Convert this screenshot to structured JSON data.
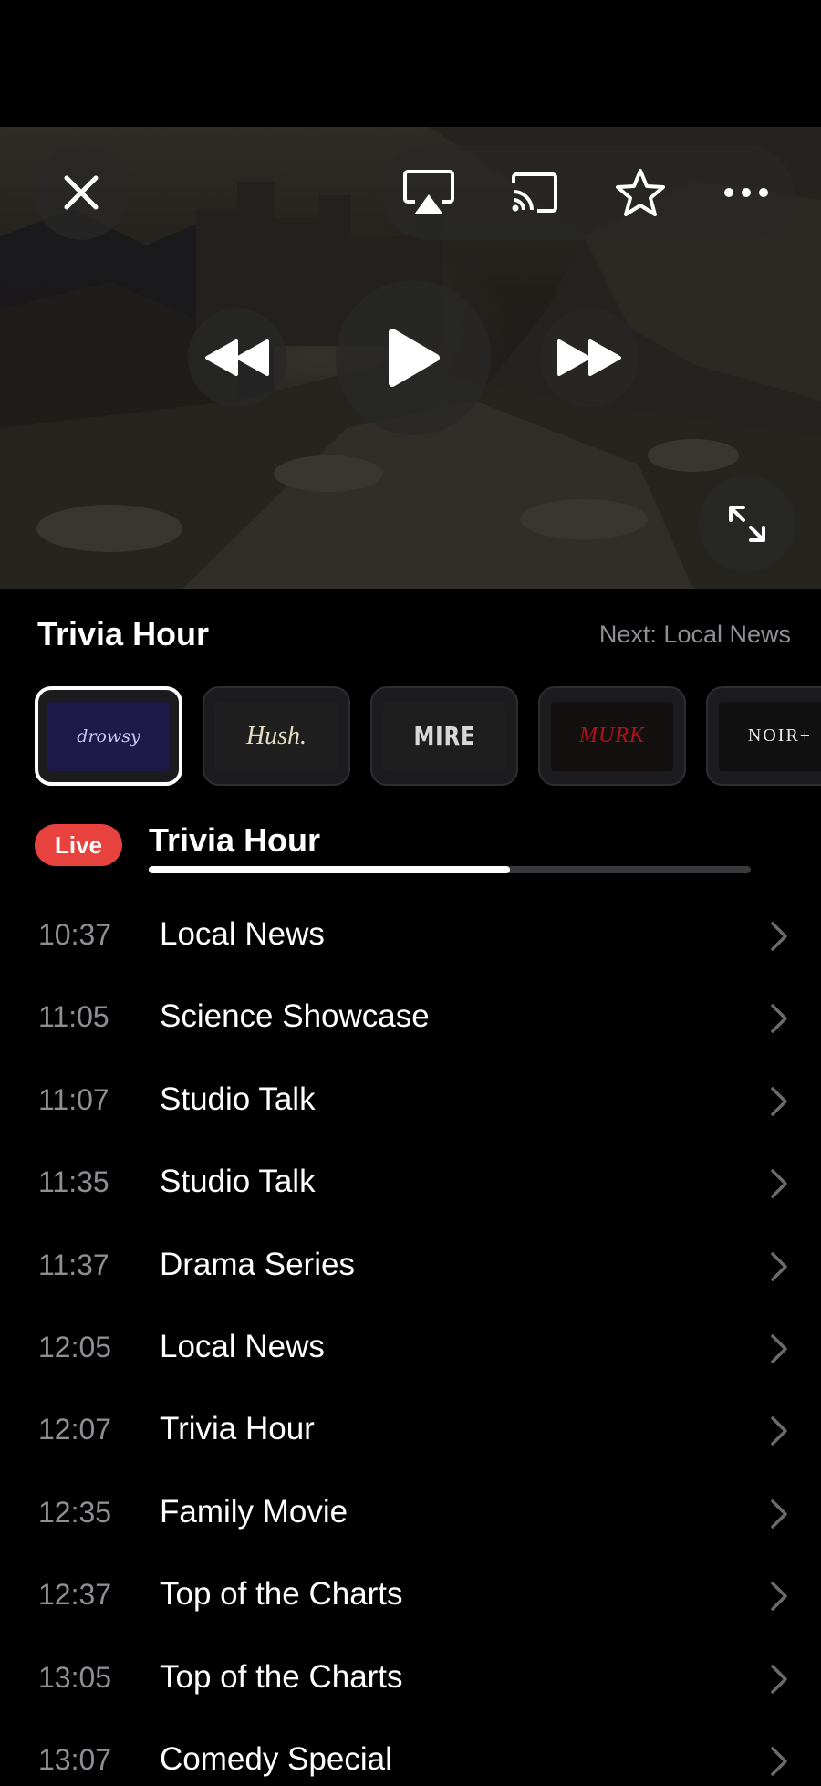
{
  "player": {
    "close_icon": "close-icon",
    "airplay_icon": "airplay-icon",
    "cast_icon": "cast-icon",
    "favorite_icon": "star-icon",
    "more_icon": "more-icon",
    "rewind_icon": "rewind-icon",
    "play_icon": "play-icon",
    "forward_icon": "fast-forward-icon",
    "fullscreen_icon": "expand-icon"
  },
  "now_playing": {
    "title": "Trivia Hour",
    "next_label": "Next: Local News"
  },
  "channels": [
    {
      "name": "drowsy",
      "logo_text": "drowsy",
      "selected": true,
      "bg": "#1d1a4a",
      "fg": "#c9c6f0"
    },
    {
      "name": "Hush.",
      "logo_text": "Hush.",
      "selected": false,
      "bg": "#1f1f1f",
      "fg": "#e6dcc4"
    },
    {
      "name": "MIRE",
      "logo_text": "MIRE",
      "selected": false,
      "bg": "#1e1e1f",
      "fg": "#d8d8d8"
    },
    {
      "name": "MURK",
      "logo_text": "MURK",
      "selected": false,
      "bg": "#141010",
      "fg": "#b0121a"
    },
    {
      "name": "NOIR+",
      "logo_text": "NOIR+",
      "selected": false,
      "bg": "#111111",
      "fg": "#e8e8e8"
    }
  ],
  "live": {
    "badge": "Live",
    "title": "Trivia Hour",
    "progress": 0.6,
    "accent": "#e8423f"
  },
  "schedule": [
    {
      "time": "10:37",
      "title": "Local News"
    },
    {
      "time": "11:05",
      "title": "Science Showcase"
    },
    {
      "time": "11:07",
      "title": "Studio Talk"
    },
    {
      "time": "11:35",
      "title": "Studio Talk"
    },
    {
      "time": "11:37",
      "title": "Drama Series"
    },
    {
      "time": "12:05",
      "title": "Local News"
    },
    {
      "time": "12:07",
      "title": "Trivia Hour"
    },
    {
      "time": "12:35",
      "title": "Family Movie"
    },
    {
      "time": "12:37",
      "title": "Top of the Charts"
    },
    {
      "time": "13:05",
      "title": "Top of the Charts"
    },
    {
      "time": "13:07",
      "title": "Comedy Special"
    }
  ]
}
